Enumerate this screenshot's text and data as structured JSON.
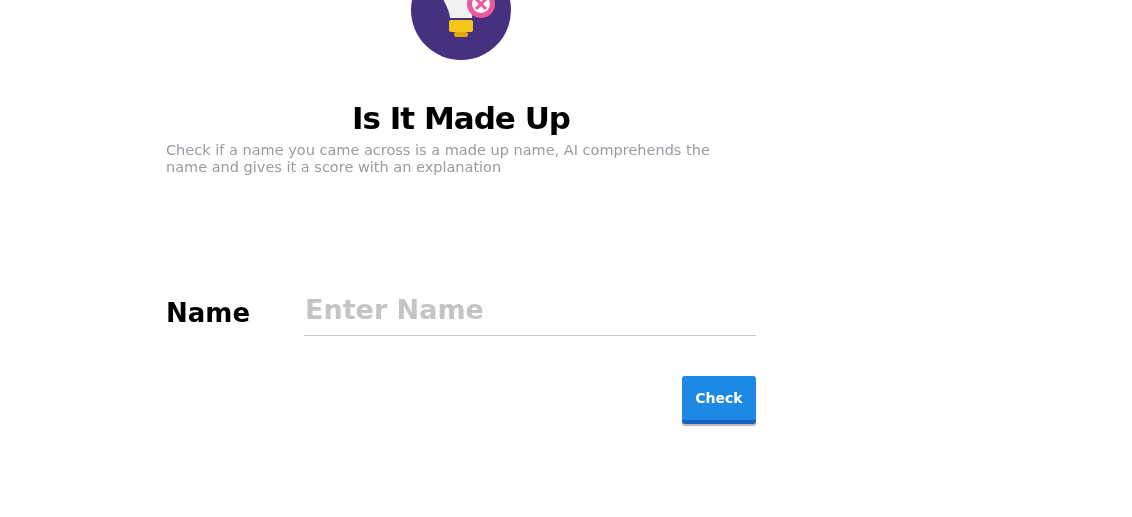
{
  "title": "Is It Made Up",
  "description": "Check if a name you came across is a made up name, AI comprehends the name and gives it a score with an explanation",
  "form": {
    "label": "Name",
    "placeholder": "Enter Name"
  },
  "button": "Check"
}
